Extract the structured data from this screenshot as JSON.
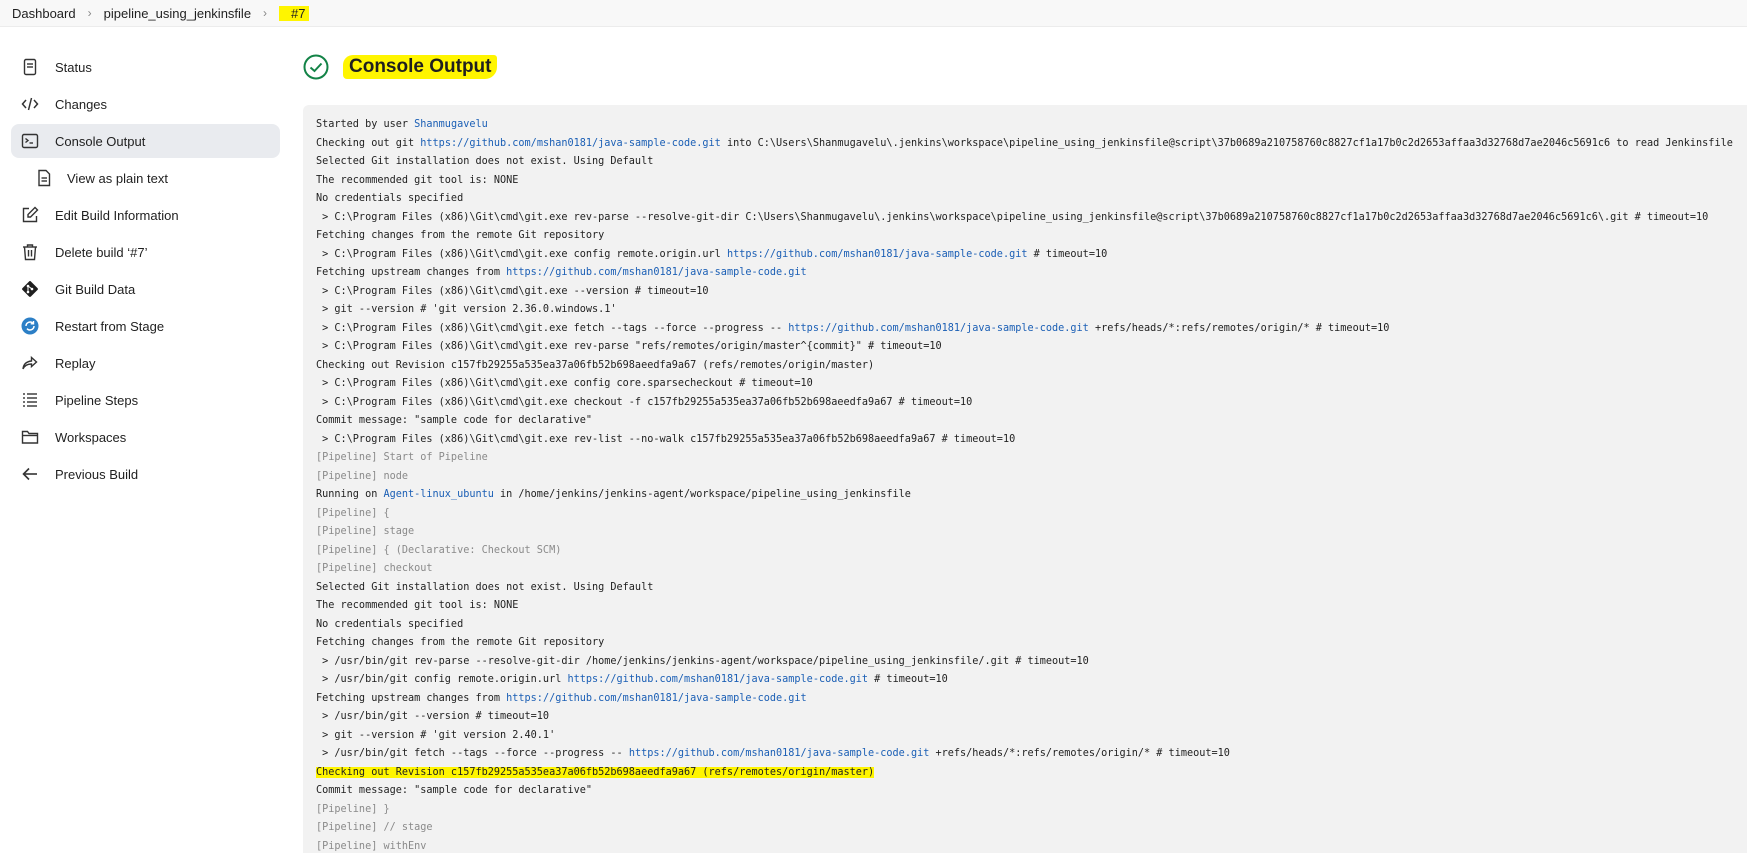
{
  "breadcrumb": [
    "Dashboard",
    "pipeline_using_jenkinsfile",
    "#7"
  ],
  "sidebar": {
    "items": [
      {
        "label": "Status",
        "icon": "status-icon"
      },
      {
        "label": "Changes",
        "icon": "code-icon"
      },
      {
        "label": "Console Output",
        "icon": "terminal-icon",
        "active": true
      },
      {
        "label": "View as plain text",
        "icon": "document-icon",
        "sub": true
      },
      {
        "label": "Edit Build Information",
        "icon": "edit-icon"
      },
      {
        "label": "Delete build ‘#7’",
        "icon": "trash-icon"
      },
      {
        "label": "Git Build Data",
        "icon": "git-icon"
      },
      {
        "label": "Restart from Stage",
        "icon": "restart-icon"
      },
      {
        "label": "Replay",
        "icon": "replay-icon"
      },
      {
        "label": "Pipeline Steps",
        "icon": "list-icon"
      },
      {
        "label": "Workspaces",
        "icon": "folder-icon"
      },
      {
        "label": "Previous Build",
        "icon": "arrow-left-icon"
      }
    ]
  },
  "main": {
    "title": "Console Output",
    "status_color": "#138347",
    "console_lines": [
      {
        "parts": [
          {
            "t": "Started by user "
          },
          {
            "t": "Shanmugavelu",
            "link": true
          }
        ]
      },
      {
        "parts": [
          {
            "t": "Checking out git "
          },
          {
            "t": "https://github.com/mshan0181/java-sample-code.git",
            "link": true
          },
          {
            "t": " into C:\\Users\\Shanmugavelu\\.jenkins\\workspace\\pipeline_using_jenkinsfile@script\\37b0689a210758760c8827cf1a17b0c2d2653affaa3d32768d7ae2046c5691c6 to read Jenkinsfile"
          }
        ]
      },
      {
        "parts": [
          {
            "t": "Selected Git installation does not exist. Using Default"
          }
        ]
      },
      {
        "parts": [
          {
            "t": "The recommended git tool is: NONE"
          }
        ]
      },
      {
        "parts": [
          {
            "t": "No credentials specified"
          }
        ]
      },
      {
        "parts": [
          {
            "t": " > C:\\Program Files (x86)\\Git\\cmd\\git.exe rev-parse --resolve-git-dir C:\\Users\\Shanmugavelu\\.jenkins\\workspace\\pipeline_using_jenkinsfile@script\\37b0689a210758760c8827cf1a17b0c2d2653affaa3d32768d7ae2046c5691c6\\.git # timeout=10"
          }
        ]
      },
      {
        "parts": [
          {
            "t": "Fetching changes from the remote Git repository"
          }
        ]
      },
      {
        "parts": [
          {
            "t": " > C:\\Program Files (x86)\\Git\\cmd\\git.exe config remote.origin.url "
          },
          {
            "t": "https://github.com/mshan0181/java-sample-code.git",
            "link": true
          },
          {
            "t": " # timeout=10"
          }
        ]
      },
      {
        "parts": [
          {
            "t": "Fetching upstream changes from "
          },
          {
            "t": "https://github.com/mshan0181/java-sample-code.git",
            "link": true
          }
        ]
      },
      {
        "parts": [
          {
            "t": " > C:\\Program Files (x86)\\Git\\cmd\\git.exe --version # timeout=10"
          }
        ]
      },
      {
        "parts": [
          {
            "t": " > git --version # 'git version 2.36.0.windows.1'"
          }
        ]
      },
      {
        "parts": [
          {
            "t": " > C:\\Program Files (x86)\\Git\\cmd\\git.exe fetch --tags --force --progress -- "
          },
          {
            "t": "https://github.com/mshan0181/java-sample-code.git",
            "link": true
          },
          {
            "t": " +refs/heads/*:refs/remotes/origin/* # timeout=10"
          }
        ]
      },
      {
        "parts": [
          {
            "t": " > C:\\Program Files (x86)\\Git\\cmd\\git.exe rev-parse \"refs/remotes/origin/master^{commit}\" # timeout=10"
          }
        ]
      },
      {
        "parts": [
          {
            "t": "Checking out Revision c157fb29255a535ea37a06fb52b698aeedfa9a67 (refs/remotes/origin/master)"
          }
        ]
      },
      {
        "parts": [
          {
            "t": " > C:\\Program Files (x86)\\Git\\cmd\\git.exe config core.sparsecheckout # timeout=10"
          }
        ]
      },
      {
        "parts": [
          {
            "t": " > C:\\Program Files (x86)\\Git\\cmd\\git.exe checkout -f c157fb29255a535ea37a06fb52b698aeedfa9a67 # timeout=10"
          }
        ]
      },
      {
        "parts": [
          {
            "t": "Commit message: \"sample code for declarative\""
          }
        ]
      },
      {
        "parts": [
          {
            "t": " > C:\\Program Files (x86)\\Git\\cmd\\git.exe rev-list --no-walk c157fb29255a535ea37a06fb52b698aeedfa9a67 # timeout=10"
          }
        ]
      },
      {
        "pipe": true,
        "parts": [
          {
            "t": "[Pipeline] Start of Pipeline"
          }
        ]
      },
      {
        "pipe": true,
        "parts": [
          {
            "t": "[Pipeline] node"
          }
        ]
      },
      {
        "parts": [
          {
            "t": "Running on "
          },
          {
            "t": "Agent-linux_ubuntu",
            "link": true
          },
          {
            "t": " in /home/jenkins/jenkins-agent/workspace/pipeline_using_jenkinsfile"
          }
        ]
      },
      {
        "pipe": true,
        "parts": [
          {
            "t": "[Pipeline] {"
          }
        ]
      },
      {
        "pipe": true,
        "parts": [
          {
            "t": "[Pipeline] stage"
          }
        ]
      },
      {
        "pipe": true,
        "parts": [
          {
            "t": "[Pipeline] { (Declarative: Checkout SCM)"
          }
        ]
      },
      {
        "pipe": true,
        "parts": [
          {
            "t": "[Pipeline] checkout"
          }
        ]
      },
      {
        "parts": [
          {
            "t": "Selected Git installation does not exist. Using Default"
          }
        ]
      },
      {
        "parts": [
          {
            "t": "The recommended git tool is: NONE"
          }
        ]
      },
      {
        "parts": [
          {
            "t": "No credentials specified"
          }
        ]
      },
      {
        "parts": [
          {
            "t": "Fetching changes from the remote Git repository"
          }
        ]
      },
      {
        "parts": [
          {
            "t": " > /usr/bin/git rev-parse --resolve-git-dir /home/jenkins/jenkins-agent/workspace/pipeline_using_jenkinsfile/.git # timeout=10"
          }
        ]
      },
      {
        "parts": [
          {
            "t": " > /usr/bin/git config remote.origin.url "
          },
          {
            "t": "https://github.com/mshan0181/java-sample-code.git",
            "link": true
          },
          {
            "t": " # timeout=10"
          }
        ]
      },
      {
        "parts": [
          {
            "t": "Fetching upstream changes from "
          },
          {
            "t": "https://github.com/mshan0181/java-sample-code.git",
            "link": true
          }
        ]
      },
      {
        "parts": [
          {
            "t": " > /usr/bin/git --version # timeout=10"
          }
        ]
      },
      {
        "parts": [
          {
            "t": " > git --version # 'git version 2.40.1'"
          }
        ]
      },
      {
        "parts": [
          {
            "t": " > /usr/bin/git fetch --tags --force --progress -- "
          },
          {
            "t": "https://github.com/mshan0181/java-sample-code.git",
            "link": true
          },
          {
            "t": " +refs/heads/*:refs/remotes/origin/* # timeout=10"
          }
        ]
      },
      {
        "highlight": true,
        "parts": [
          {
            "t": "Checking out Revision c157fb29255a535ea37a06fb52b698aeedfa9a67 (refs/remotes/origin/master)"
          }
        ]
      },
      {
        "parts": [
          {
            "t": "Commit message: \"sample code for declarative\""
          }
        ]
      },
      {
        "pipe": true,
        "parts": [
          {
            "t": "[Pipeline] }"
          }
        ]
      },
      {
        "pipe": true,
        "parts": [
          {
            "t": "[Pipeline] // stage"
          }
        ]
      },
      {
        "pipe": true,
        "parts": [
          {
            "t": "[Pipeline] withEnv"
          }
        ]
      }
    ]
  }
}
